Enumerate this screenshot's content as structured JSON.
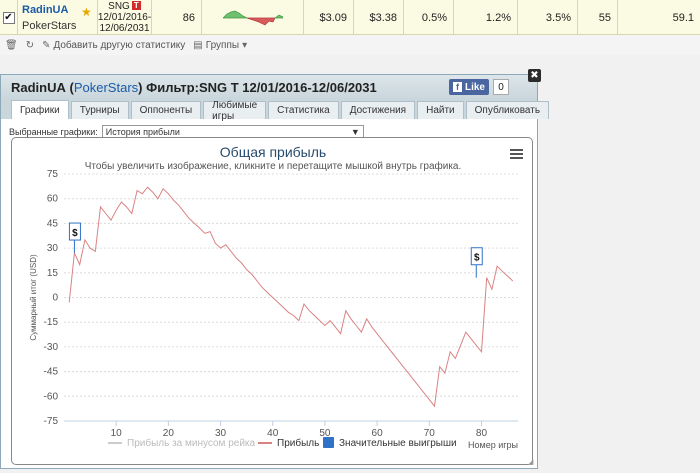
{
  "stats_row": {
    "player": "RadinUA",
    "site": "PokerStars",
    "game": "SNG",
    "game_badge": "T",
    "date_from": "12/01/2016-",
    "date_to": "12/06/2031",
    "games": "86",
    "values": [
      "$3.09",
      "$3.38",
      "0.5%",
      "1.2%",
      "3.5%",
      "55",
      "59.1"
    ]
  },
  "toolbar": {
    "add_stats": "Добавить другую статистику",
    "groups": "Группы"
  },
  "panel": {
    "player": "RadinUA",
    "site": "PokerStars",
    "filter_label": "Фильтр:SNG T 12/01/2016-12/06/2031",
    "fb_like": "Like",
    "fb_count": "0",
    "tabs": [
      "Графики",
      "Турниры",
      "Оппоненты",
      "Любимые игры",
      "Статистика",
      "Достижения",
      "Найти",
      "Опубликовать"
    ],
    "select_label": "Выбранные графики:",
    "select_value": "История прибыли"
  },
  "chart_data": {
    "type": "line",
    "title": "Общая прибыль",
    "subtitle": "Чтобы увеличить изображение, кликните и перетащите мышкой внутрь графика.",
    "ylabel": "Суммарный итог (USD)",
    "xlabel": "Номер игры",
    "xlim": [
      0,
      87
    ],
    "ylim": [
      -75,
      75
    ],
    "yticks": [
      75,
      60,
      45,
      30,
      15,
      0,
      -15,
      -30,
      -45,
      -60,
      -75
    ],
    "xticks": [
      10,
      20,
      30,
      40,
      50,
      60,
      70,
      80
    ],
    "legend": [
      "Прибыль за минусом рейка",
      "Прибыль",
      "Значительные выигрыши"
    ],
    "legend_colors": [
      "#cccccc",
      "#d98282",
      "#2f72c8"
    ],
    "series": [
      {
        "name": "Прибыль",
        "color": "#d98282",
        "x": [
          1,
          2,
          3,
          4,
          5,
          6,
          7,
          8,
          9,
          10,
          11,
          12,
          13,
          14,
          15,
          16,
          17,
          18,
          19,
          20,
          21,
          22,
          23,
          24,
          25,
          26,
          27,
          28,
          29,
          30,
          31,
          32,
          33,
          34,
          35,
          36,
          37,
          38,
          39,
          40,
          41,
          42,
          43,
          44,
          45,
          46,
          47,
          48,
          49,
          50,
          51,
          52,
          53,
          54,
          55,
          56,
          57,
          58,
          59,
          60,
          61,
          62,
          63,
          64,
          65,
          66,
          67,
          68,
          69,
          70,
          71,
          72,
          73,
          74,
          75,
          76,
          77,
          78,
          79,
          80,
          81,
          82,
          83,
          84,
          85,
          86
        ],
        "y": [
          -3,
          27,
          20,
          35,
          30,
          28,
          55,
          51,
          47,
          53,
          58,
          55,
          51,
          65,
          63,
          67,
          64,
          60,
          66,
          63,
          59,
          56,
          52,
          48,
          45,
          42,
          39,
          40,
          33,
          30,
          32,
          28,
          24,
          21,
          17,
          14,
          10,
          6,
          3,
          0,
          -3,
          -6,
          -9,
          -11,
          -14,
          -4,
          -8,
          -11,
          -14,
          -17,
          -14,
          -18,
          -22,
          -8,
          -13,
          -17,
          -21,
          -13,
          -18,
          -22,
          -26,
          -30,
          -34,
          -38,
          -42,
          -46,
          -50,
          -54,
          -58,
          -62,
          -66,
          -42,
          -46,
          -33,
          -37,
          -29,
          -21,
          -25,
          -29,
          -33,
          12,
          5,
          19,
          16,
          13,
          10
        ],
        "big_wins": [
          [
            2,
            27
          ],
          [
            79,
            12
          ]
        ]
      }
    ]
  }
}
